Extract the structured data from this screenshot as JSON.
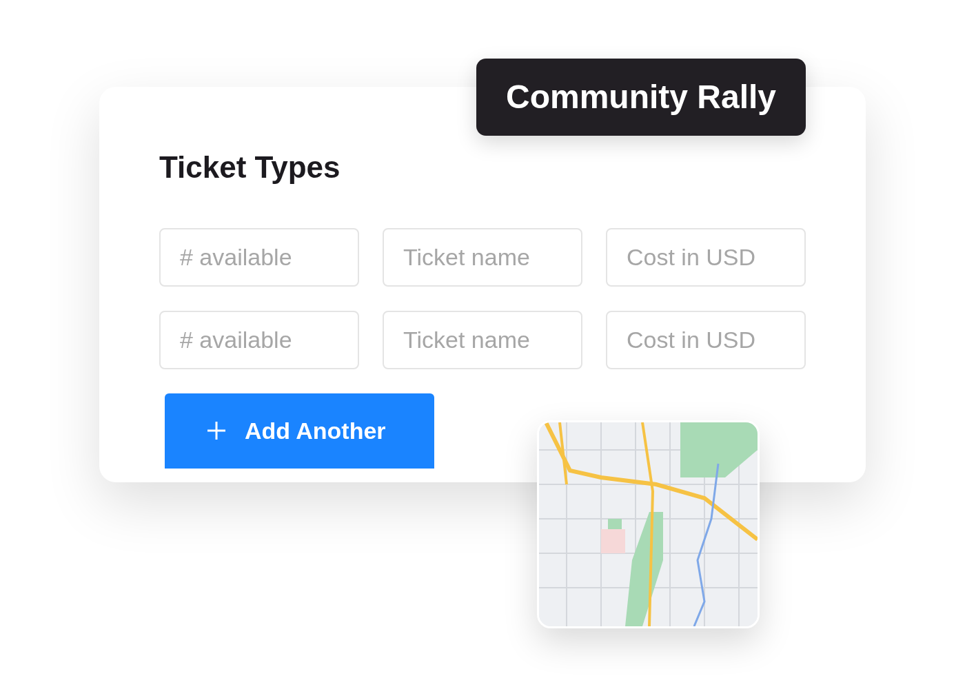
{
  "event_badge": {
    "title": "Community Rally"
  },
  "section": {
    "title": "Ticket Types"
  },
  "ticket_rows": [
    {
      "fields": [
        {
          "placeholder": "# available"
        },
        {
          "placeholder": "Ticket name"
        },
        {
          "placeholder": "Cost in USD"
        }
      ]
    },
    {
      "fields": [
        {
          "placeholder": "# available"
        },
        {
          "placeholder": "Ticket name"
        },
        {
          "placeholder": "Cost in USD"
        }
      ]
    }
  ],
  "add_button": {
    "label": "Add Another"
  }
}
